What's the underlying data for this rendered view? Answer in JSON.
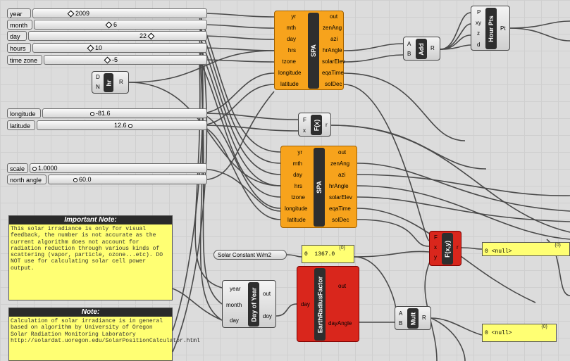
{
  "sliders": {
    "year": {
      "label": "year",
      "value": "2009"
    },
    "month": {
      "label": "month",
      "value": "6"
    },
    "day": {
      "label": "day",
      "value": "22"
    },
    "hours": {
      "label": "hours",
      "value": "10"
    },
    "time_zone": {
      "label": "time zone",
      "value": "-5"
    },
    "longitude": {
      "label": "longitude",
      "value": "-81.6"
    },
    "latitude": {
      "label": "latitude",
      "value": "12.6"
    },
    "scale": {
      "label": "scale",
      "value": "1.0000"
    },
    "north_angle": {
      "label": "north angle",
      "value": "60.0"
    }
  },
  "spa_top": {
    "name": "SPA",
    "inputs": [
      "yr",
      "mth",
      "day",
      "hrs",
      "tzone",
      "longitude",
      "latitude"
    ],
    "outputs": [
      "out",
      "zenAng",
      "azi",
      "hrAngle",
      "solarElev",
      "eqaTime",
      "solDec"
    ]
  },
  "spa_bottom": {
    "name": "SPA",
    "inputs": [
      "yr",
      "mth",
      "day",
      "hrs",
      "tzone",
      "longitude",
      "latitude"
    ],
    "outputs": [
      "out",
      "zenAng",
      "azi",
      "hrAngle",
      "solarElev",
      "eqaTime",
      "solDec"
    ]
  },
  "hr": {
    "name": "hr",
    "in_d": "D",
    "in_n": "N",
    "out_r": "R"
  },
  "add": {
    "name": "Add",
    "in_a": "A",
    "in_b": "B",
    "out_r": "R"
  },
  "hourpts": {
    "name": "Hour Pts",
    "in_p": "P",
    "in_xy": "xy",
    "in_z": "z",
    "in_d": "d",
    "out_pt": "Pt"
  },
  "fx": {
    "name": "F(x)",
    "in_f": "F",
    "in_x": "x",
    "out_r": "r"
  },
  "fxy": {
    "name": "F(x,y)",
    "in_f": "F",
    "in_x": "x",
    "in_y": "y",
    "out_r": "r"
  },
  "solar_constant": {
    "label": "Solar Constant W/m2",
    "value_index": "0",
    "value": "1367.0",
    "header": "{0}"
  },
  "day_of_year": {
    "name": "Day of Year",
    "in_year": "year",
    "in_month": "month",
    "in_day": "day",
    "out_out": "out",
    "out_doy": "doy"
  },
  "earth_radius": {
    "name": "EarthRadiusFactor",
    "in_day": "day",
    "out_out": "out",
    "out_dayangle": "dayAngle"
  },
  "mult": {
    "name": "Mult",
    "in_a": "A",
    "in_b": "B",
    "out_r": "R"
  },
  "null_panel_1": {
    "header": "{0}",
    "index": "0",
    "value": "<null>"
  },
  "null_panel_2": {
    "header": "{0}",
    "index": "0",
    "value": "<null>"
  },
  "note_important": {
    "title": "Important Note:",
    "body": "This solar irradiance is only for visual feedback, the number is not accurate as the current algorithm does not account for radiation reduction through various kinds of scattering (vapor, particle, ozone...etc). DO NOT use for calculating solar cell power output."
  },
  "note_calc": {
    "title": "Note:",
    "body": "Calculation of solar irradiance is in general based on algorithm by University of Oregon Solar Radiation Monitoring Laboratory\nhttp://solardat.uoregon.edu/SolarPositionCalculator.html"
  }
}
